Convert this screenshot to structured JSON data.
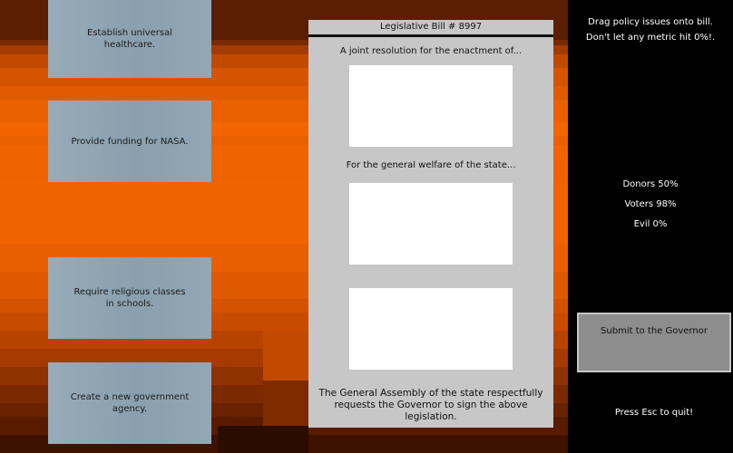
{
  "policies": [
    {
      "label": "Establish universal\nhealthcare."
    },
    {
      "label": "Provide funding for NASA."
    },
    {
      "label": "Require religious classes\nin schools."
    },
    {
      "label": "Create a new government\nagency."
    }
  ],
  "bill": {
    "title": "Legislative Bill # 8997",
    "preamble": "A joint resolution for the enactment of...",
    "welfare": "For the general welfare of the state...",
    "closing_1": "The General Assembly of the state respectfully",
    "closing_2": "requests the Governor to sign the above legislation."
  },
  "sidebar": {
    "instructions": "Drag policy issues onto bill.\nDon't let any metric hit 0%!.",
    "metrics": {
      "donors": "Donors 50%",
      "voters": "Voters 98%",
      "evil": "Evil 0%"
    },
    "submit_label": "Submit to the Governor",
    "quit_hint": "Press Esc to quit!"
  },
  "colors": {
    "background_gradient": [
      "#5a1d00",
      "#d95800",
      "#ee6300",
      "#b04200",
      "#4a1500"
    ],
    "card": "#8fa3b0",
    "bill_paper": "#c7c7c7",
    "slot": "#ffffff"
  }
}
